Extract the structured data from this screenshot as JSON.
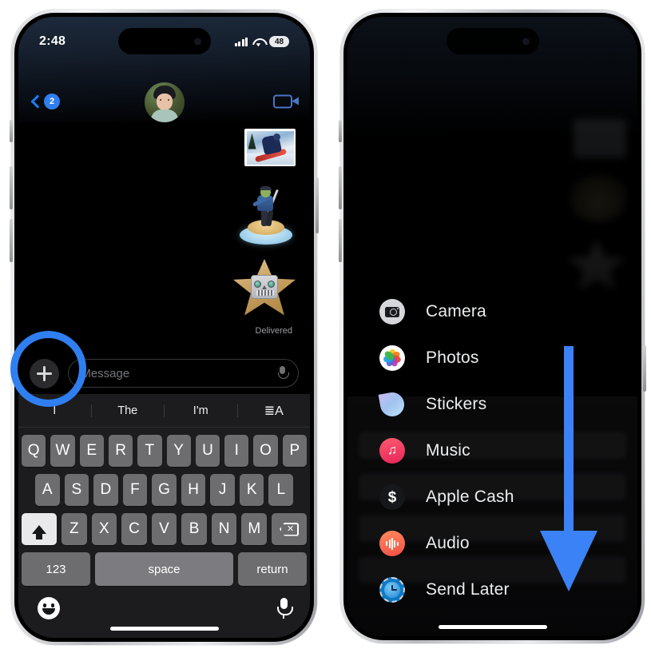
{
  "left_phone": {
    "status_bar": {
      "time": "2:48",
      "signal_icon": "cellular-signal-icon",
      "wifi_icon": "wifi-icon",
      "battery_level": "48"
    },
    "nav_bar": {
      "back_icon": "chevron-left-icon",
      "unread_badge": "2",
      "avatar_name": "contact-avatar",
      "facetime_icon": "video-camera-icon"
    },
    "messages": [
      {
        "type": "photo-sticker",
        "name": "snowboarder-photo-sticker"
      },
      {
        "type": "figure-sticker",
        "name": "golfer-figurine-sticker"
      },
      {
        "type": "star-sticker",
        "name": "robot-star-sticker"
      }
    ],
    "delivery_status": "Delivered",
    "input_bar": {
      "plus_icon": "plus-icon",
      "placeholder": "iMessage",
      "mic_icon": "microphone-icon"
    },
    "keyboard": {
      "predictions": [
        "I",
        "The",
        "I'm"
      ],
      "format_icon": "text-format-icon",
      "row1": [
        "Q",
        "W",
        "E",
        "R",
        "T",
        "Y",
        "U",
        "I",
        "O",
        "P"
      ],
      "row2": [
        "A",
        "S",
        "D",
        "F",
        "G",
        "H",
        "J",
        "K",
        "L"
      ],
      "row3": [
        "Z",
        "X",
        "C",
        "V",
        "B",
        "N",
        "M"
      ],
      "shift_icon": "shift-arrow-icon",
      "delete_icon": "delete-backspace-icon",
      "numbers_key": "123",
      "space_key": "space",
      "return_key": "return",
      "emoji_icon": "emoji-smiley-icon",
      "dictation_icon": "microphone-icon"
    }
  },
  "right_phone": {
    "menu_title": "attachment-menu",
    "items": [
      {
        "label": "Camera",
        "icon": "camera-icon"
      },
      {
        "label": "Photos",
        "icon": "photos-icon"
      },
      {
        "label": "Stickers",
        "icon": "stickers-icon"
      },
      {
        "label": "Music",
        "icon": "music-note-icon"
      },
      {
        "label": "Apple Cash",
        "icon": "dollar-sign-icon"
      },
      {
        "label": "Audio",
        "icon": "audio-waveform-icon"
      },
      {
        "label": "Send Later",
        "icon": "clock-icon"
      }
    ]
  },
  "annotations": {
    "highlight_circle": "plus-button-highlight",
    "arrow": "scroll-down-arrow"
  },
  "colors": {
    "accent_blue": "#2f7ff0",
    "arrow_blue": "#3b82f6",
    "keyboard_bg": "#1c1c1e",
    "key_gray": "#6d6d70",
    "music_red": "#e8265a",
    "audio_orange": "#ef4f46"
  }
}
